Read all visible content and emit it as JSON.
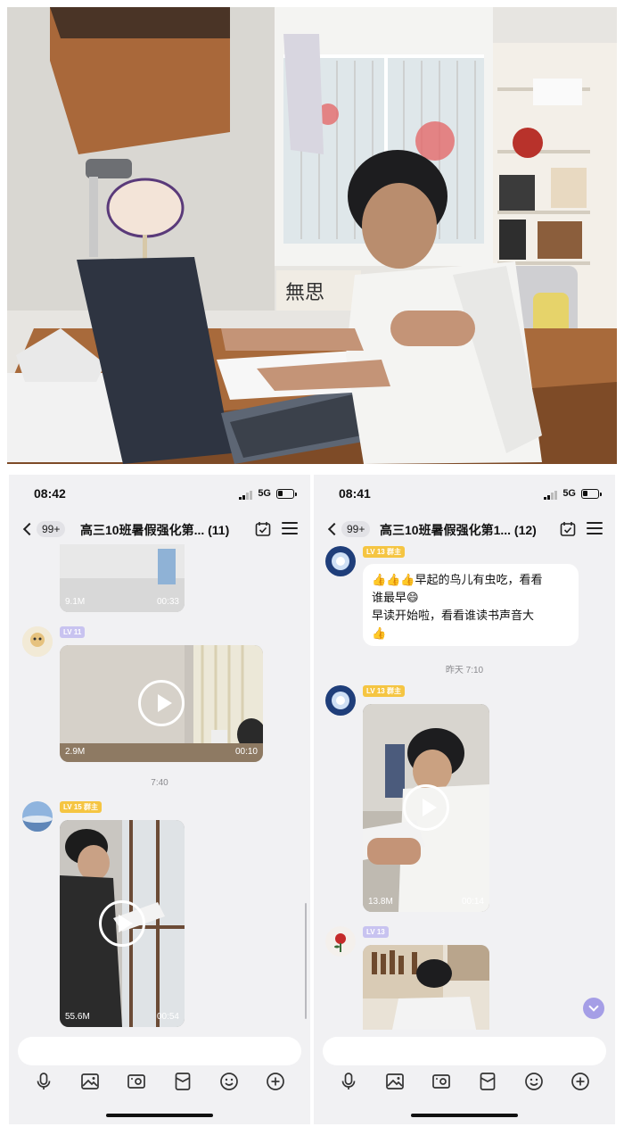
{
  "left_phone": {
    "status": {
      "time": "08:42",
      "network": "5G"
    },
    "nav": {
      "unread_count": "99+",
      "title": "高三10班暑假强化第... (11)"
    },
    "messages": [
      {
        "type": "video",
        "size": "9.1M",
        "duration": "00:33"
      },
      {
        "type": "video",
        "level_badge": "LV 11",
        "size": "2.9M",
        "duration": "00:10"
      },
      {
        "type": "timestamp",
        "text": "7:40"
      },
      {
        "type": "video",
        "level_badge": "LV 15 群主",
        "size": "55.6M",
        "duration": "00:54"
      }
    ]
  },
  "right_phone": {
    "status": {
      "time": "08:41",
      "network": "5G"
    },
    "nav": {
      "unread_count": "99+",
      "title": "高三10班暑假强化第1... (12)"
    },
    "messages": [
      {
        "type": "text",
        "level_badge": "LV 13 群主",
        "line1": "👍👍👍早起的鸟儿有虫吃，看看",
        "line2": "谁最早😄",
        "line3": "早读开始啦，看看谁读书声音大",
        "line4": "👍"
      },
      {
        "type": "timestamp",
        "text": "昨天 7:10"
      },
      {
        "type": "video",
        "level_badge": "LV 13 群主",
        "size": "13.8M",
        "duration": "00:14"
      },
      {
        "type": "video",
        "level_badge": "LV 13"
      }
    ]
  },
  "icons": {
    "toolbar": [
      "microphone-icon",
      "image-icon",
      "camera-icon",
      "red-packet-icon",
      "emoji-icon",
      "plus-icon"
    ],
    "nav": [
      "back-chevron-icon",
      "calendar-check-icon",
      "menu-icon"
    ]
  },
  "colors": {
    "owner_badge": "#f5c542",
    "level_badge": "#c8c3f0",
    "scroll_down_button": "#a59ee6",
    "chat_background": "#f1f1f3"
  }
}
